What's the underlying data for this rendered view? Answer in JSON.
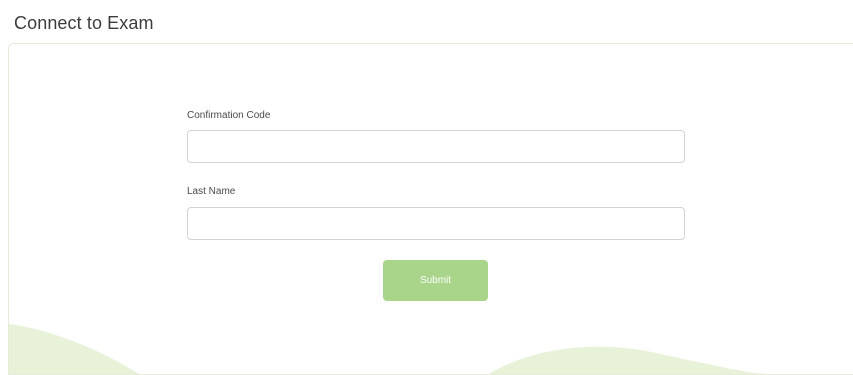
{
  "page": {
    "title": "Connect to Exam"
  },
  "form": {
    "confirmation_code": {
      "label": "Confirmation Code",
      "value": "",
      "placeholder": ""
    },
    "last_name": {
      "label": "Last Name",
      "value": "",
      "placeholder": ""
    },
    "submit_label": "Submit"
  },
  "colors": {
    "accent": "#a9d58a",
    "wave": "#e7f2d9",
    "title_text": "#3c3c3c"
  }
}
